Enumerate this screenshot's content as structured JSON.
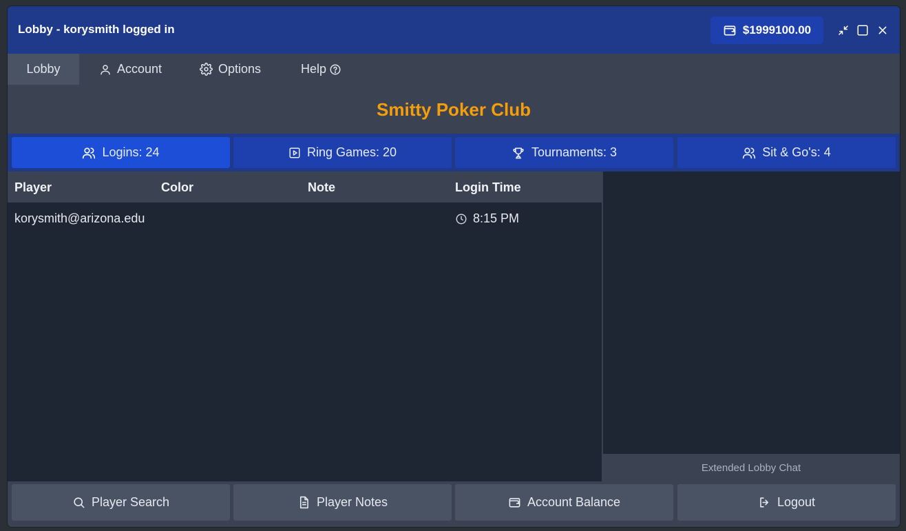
{
  "window": {
    "title": "Lobby - korysmith logged in",
    "balance": "$1999100.00"
  },
  "menu": {
    "items": [
      {
        "label": "Lobby",
        "icon": "none"
      },
      {
        "label": "Account",
        "icon": "user-icon"
      },
      {
        "label": "Options",
        "icon": "gear-icon"
      },
      {
        "label": "Help",
        "icon": "help-circle-icon"
      }
    ]
  },
  "club_name": "Smitty Poker Club",
  "tabs": [
    {
      "label": "Logins: 24",
      "icon": "users-icon",
      "active": true
    },
    {
      "label": "Ring Games: 20",
      "icon": "play-square-icon",
      "active": false
    },
    {
      "label": "Tournaments: 3",
      "icon": "trophy-icon",
      "active": false
    },
    {
      "label": "Sit & Go's: 4",
      "icon": "users-icon",
      "active": false
    }
  ],
  "table": {
    "columns": [
      "Player",
      "Color",
      "Note",
      "Login Time"
    ],
    "rows": [
      {
        "player": "korysmith@arizona.edu",
        "color": "",
        "note": "",
        "login_time": "8:15 PM"
      }
    ]
  },
  "chat": {
    "label": "Extended Lobby Chat"
  },
  "bottom_buttons": [
    {
      "label": "Player Search",
      "icon": "search-icon"
    },
    {
      "label": "Player Notes",
      "icon": "document-icon"
    },
    {
      "label": "Account Balance",
      "icon": "wallet-icon"
    },
    {
      "label": "Logout",
      "icon": "logout-icon"
    }
  ],
  "colors": {
    "accent": "#f59e0b",
    "titlebar": "#1f3a8a",
    "tab_active": "#1d4ed8",
    "tab": "#1e40af"
  }
}
